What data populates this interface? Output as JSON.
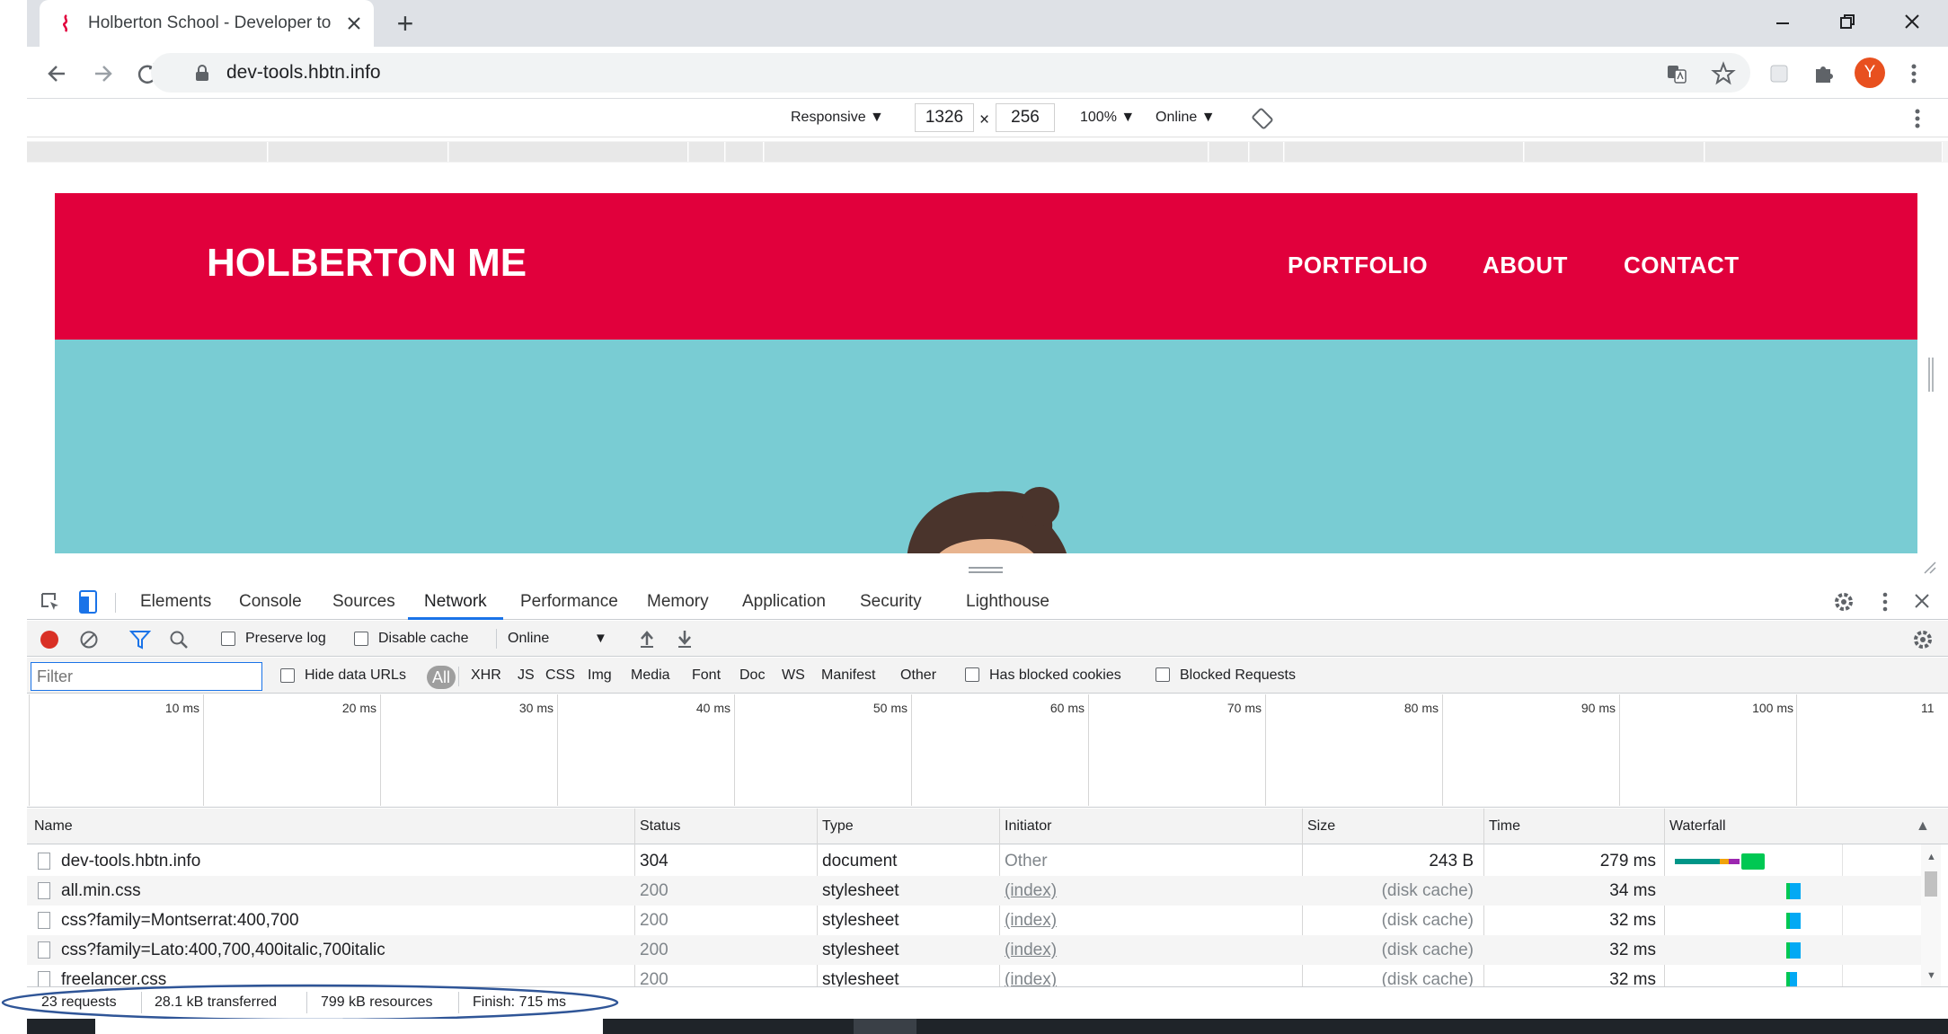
{
  "browser": {
    "tab_title": "Holberton School - Developer to",
    "new_tab_symbol": "+",
    "url": "dev-tools.hbtn.info",
    "profile_initial": "Y"
  },
  "device_toolbar": {
    "device": "Responsive",
    "width": "1326",
    "times": "×",
    "height": "256",
    "zoom": "100%",
    "throttle": "Online"
  },
  "site": {
    "logo": "HOLBERTON ME",
    "nav": [
      "PORTFOLIO",
      "ABOUT",
      "CONTACT"
    ],
    "header_color": "#e1003c",
    "hero_color": "#79ccd3"
  },
  "devtools": {
    "tabs": [
      "Elements",
      "Console",
      "Sources",
      "Network",
      "Performance",
      "Memory",
      "Application",
      "Security",
      "Lighthouse"
    ],
    "active_tab": "Network",
    "toolbar": {
      "preserve_log": "Preserve log",
      "disable_cache": "Disable cache",
      "throttle": "Online"
    },
    "filter": {
      "placeholder": "Filter",
      "hide_data_urls": "Hide data URLs",
      "types": [
        "All",
        "XHR",
        "JS",
        "CSS",
        "Img",
        "Media",
        "Font",
        "Doc",
        "WS",
        "Manifest",
        "Other"
      ],
      "has_blocked_cookies": "Has blocked cookies",
      "blocked_requests": "Blocked Requests"
    },
    "overview_ticks": [
      "10 ms",
      "20 ms",
      "30 ms",
      "40 ms",
      "50 ms",
      "60 ms",
      "70 ms",
      "80 ms",
      "90 ms",
      "100 ms",
      "11"
    ],
    "columns": [
      "Name",
      "Status",
      "Type",
      "Initiator",
      "Size",
      "Time",
      "Waterfall"
    ],
    "sort_indicator": "▲",
    "rows": [
      {
        "name": "dev-tools.hbtn.info",
        "status": "304",
        "type": "document",
        "initiator": "Other",
        "size": "243 B",
        "time": "279 ms"
      },
      {
        "name": "all.min.css",
        "status": "200",
        "type": "stylesheet",
        "initiator": "(index)",
        "size": "(disk cache)",
        "time": "34 ms"
      },
      {
        "name": "css?family=Montserrat:400,700",
        "status": "200",
        "type": "stylesheet",
        "initiator": "(index)",
        "size": "(disk cache)",
        "time": "32 ms"
      },
      {
        "name": "css?family=Lato:400,700,400italic,700italic",
        "status": "200",
        "type": "stylesheet",
        "initiator": "(index)",
        "size": "(disk cache)",
        "time": "32 ms"
      },
      {
        "name": "freelancer.css",
        "status": "200",
        "type": "stylesheet",
        "initiator": "(index)",
        "size": "(disk cache)",
        "time": "32 ms"
      }
    ],
    "summary": {
      "requests": "23 requests",
      "transferred": "28.1 kB transferred",
      "resources": "799 kB resources",
      "finish": "Finish: 715 ms"
    },
    "colors": {
      "accent": "#1a73e8",
      "record": "#d93025",
      "annotation": "#2f5597"
    }
  }
}
